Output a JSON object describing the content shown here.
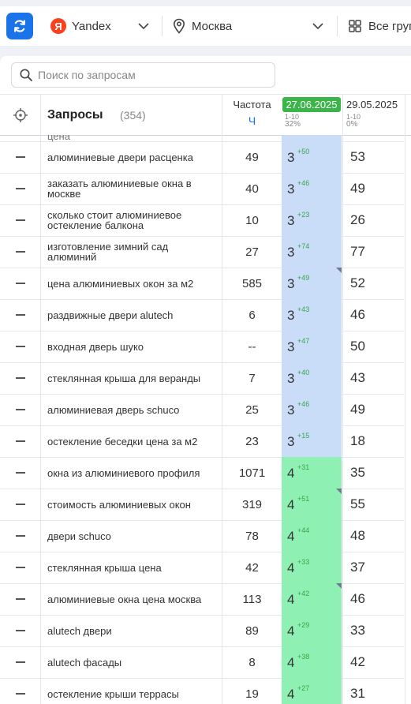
{
  "toolbar": {
    "engine": "Yandex",
    "engine_logo_letter": "Я",
    "region": "Москва",
    "groups": "Все груп"
  },
  "search": {
    "placeholder": "Поиск по запросам"
  },
  "table": {
    "headers": {
      "query": "Запросы",
      "count": "(354)",
      "frequency": "Частота",
      "frequency_unit": "Ч",
      "date1": "27.06.2025",
      "date1_range": "1-10",
      "date1_pct": "32%",
      "date2": "29.05.2025",
      "date2_range": "1-10",
      "date2_pct": "0%"
    },
    "partial_row_text": "цена",
    "rows": [
      {
        "query": "алюминиевые двери расценка",
        "freq": "49",
        "pos": "3",
        "delta": "+50",
        "prev": "53",
        "flag": false,
        "tone": "blue"
      },
      {
        "query": "заказать алюминиевые окна в москве",
        "freq": "40",
        "pos": "3",
        "delta": "+46",
        "prev": "49",
        "flag": false,
        "tone": "blue"
      },
      {
        "query": "сколько стоит алюминиевое остекление балкона",
        "freq": "10",
        "pos": "3",
        "delta": "+23",
        "prev": "26",
        "flag": false,
        "tone": "blue"
      },
      {
        "query": "изготовление зимний сад алюминий",
        "freq": "27",
        "pos": "3",
        "delta": "+74",
        "prev": "77",
        "flag": false,
        "tone": "blue"
      },
      {
        "query": "цена алюминиевых окон за м2",
        "freq": "585",
        "pos": "3",
        "delta": "+49",
        "prev": "52",
        "flag": true,
        "tone": "blue"
      },
      {
        "query": "раздвижные двери alutech",
        "freq": "6",
        "pos": "3",
        "delta": "+43",
        "prev": "46",
        "flag": false,
        "tone": "blue"
      },
      {
        "query": "входная дверь шуко",
        "freq": "--",
        "pos": "3",
        "delta": "+47",
        "prev": "50",
        "flag": false,
        "tone": "blue"
      },
      {
        "query": "стеклянная крыша для веранды",
        "freq": "7",
        "pos": "3",
        "delta": "+40",
        "prev": "43",
        "flag": false,
        "tone": "blue"
      },
      {
        "query": "алюминиевая дверь schuco",
        "freq": "25",
        "pos": "3",
        "delta": "+46",
        "prev": "49",
        "flag": false,
        "tone": "blue"
      },
      {
        "query": "остекление беседки цена за м2",
        "freq": "23",
        "pos": "3",
        "delta": "+15",
        "prev": "18",
        "flag": false,
        "tone": "blue"
      },
      {
        "query": "окна из алюминиевого профиля",
        "freq": "1071",
        "pos": "4",
        "delta": "+31",
        "prev": "35",
        "flag": false,
        "tone": "green"
      },
      {
        "query": "стоимость алюминиевых окон",
        "freq": "319",
        "pos": "4",
        "delta": "+51",
        "prev": "55",
        "flag": true,
        "tone": "green"
      },
      {
        "query": "двери schuco",
        "freq": "78",
        "pos": "4",
        "delta": "+44",
        "prev": "48",
        "flag": false,
        "tone": "green"
      },
      {
        "query": "стеклянная крыша цена",
        "freq": "42",
        "pos": "4",
        "delta": "+33",
        "prev": "37",
        "flag": false,
        "tone": "green"
      },
      {
        "query": "алюминиевые окна цена москва",
        "freq": "113",
        "pos": "4",
        "delta": "+42",
        "prev": "46",
        "flag": true,
        "tone": "green"
      },
      {
        "query": "alutech двери",
        "freq": "89",
        "pos": "4",
        "delta": "+29",
        "prev": "33",
        "flag": false,
        "tone": "green"
      },
      {
        "query": "alutech фасады",
        "freq": "8",
        "pos": "4",
        "delta": "+38",
        "prev": "42",
        "flag": false,
        "tone": "green"
      },
      {
        "query": "остекление крыши террасы",
        "freq": "19",
        "pos": "4",
        "delta": "+27",
        "prev": "31",
        "flag": false,
        "tone": "green"
      }
    ]
  },
  "colors": {
    "accent": "#1a73e8",
    "pos_blue": "#c9dcf8",
    "pos_green": "#8ff0b4",
    "delta_green": "#3aa648",
    "date_badge": "#3bb54a"
  }
}
